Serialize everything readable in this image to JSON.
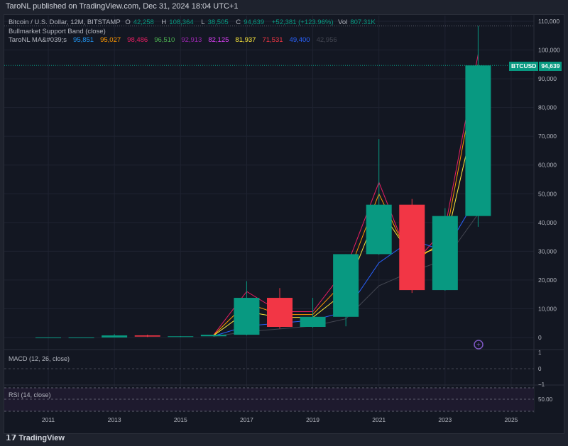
{
  "header": {
    "published": "TaroNL published on TradingView.com, Dec 31, 2024 18:04 UTC+1"
  },
  "legend": {
    "symbol": "Bitcoin / U.S. Dollar, 12M, BITSTAMP",
    "o_label": "O",
    "o": "42,258",
    "h_label": "H",
    "h": "108,364",
    "l_label": "L",
    "l": "38,505",
    "c_label": "C",
    "c": "94,639",
    "change": "+52,381 (+123.96%)",
    "vol_label": "Vol",
    "vol": "807.31K",
    "band": "Bullmarket Support Band (close)",
    "ma_title": "TaroNL MA&#039;s",
    "ma_values": [
      {
        "v": "95,851",
        "color": "#2196f3"
      },
      {
        "v": "95,027",
        "color": "#ff9800"
      },
      {
        "v": "98,486",
        "color": "#e91e63"
      },
      {
        "v": "96,510",
        "color": "#4caf50"
      },
      {
        "v": "92,913",
        "color": "#9c27b0"
      },
      {
        "v": "82,125",
        "color": "#e040fb"
      },
      {
        "v": "81,937",
        "color": "#ffeb3b"
      },
      {
        "v": "71,531",
        "color": "#f23645"
      },
      {
        "v": "49,400",
        "color": "#2962ff"
      },
      {
        "v": "42,956",
        "color": "#434651"
      }
    ]
  },
  "price_tag": {
    "symbol": "BTCUSD",
    "value": "94,639"
  },
  "macd": {
    "label": "MACD (12, 26, close)",
    "ticks": [
      "1",
      "0",
      "−1"
    ]
  },
  "rsi": {
    "label": "RSI (14, close)",
    "tick": "50.00"
  },
  "brand": "TradingView",
  "colors": {
    "up": "#089981",
    "down": "#f23645"
  },
  "chart_data": {
    "type": "candlestick",
    "ylim": [
      0,
      110000
    ],
    "yticks": [
      0,
      10000,
      20000,
      30000,
      40000,
      50000,
      60000,
      70000,
      80000,
      90000,
      100000,
      110000
    ],
    "ytick_labels": [
      "0",
      "10,000",
      "20,000",
      "30,000",
      "40,000",
      "50,000",
      "60,000",
      "70,000",
      "80,000",
      "90,000",
      "100,000",
      "110,000"
    ],
    "xticks": [
      "2011",
      "2013",
      "2015",
      "2017",
      "2019",
      "2021",
      "2023",
      "2025"
    ],
    "candles": [
      {
        "year": 2011,
        "o": 0.3,
        "h": 32,
        "l": 0.3,
        "c": 4.7
      },
      {
        "year": 2012,
        "o": 4.7,
        "h": 16,
        "l": 4,
        "c": 13
      },
      {
        "year": 2013,
        "o": 13,
        "h": 1160,
        "l": 13,
        "c": 730
      },
      {
        "year": 2014,
        "o": 730,
        "h": 1000,
        "l": 180,
        "c": 320
      },
      {
        "year": 2015,
        "o": 320,
        "h": 500,
        "l": 150,
        "c": 430
      },
      {
        "year": 2016,
        "o": 430,
        "h": 980,
        "l": 350,
        "c": 960
      },
      {
        "year": 2017,
        "o": 960,
        "h": 19600,
        "l": 750,
        "c": 13800
      },
      {
        "year": 2018,
        "o": 13800,
        "h": 17200,
        "l": 3100,
        "c": 3700
      },
      {
        "year": 2019,
        "o": 3700,
        "h": 13800,
        "l": 3400,
        "c": 7200
      },
      {
        "year": 2020,
        "o": 7200,
        "h": 29000,
        "l": 3900,
        "c": 29000
      },
      {
        "year": 2021,
        "o": 29000,
        "h": 69000,
        "l": 28800,
        "c": 46200
      },
      {
        "year": 2022,
        "o": 46200,
        "h": 48200,
        "l": 15500,
        "c": 16500
      },
      {
        "year": 2023,
        "o": 16500,
        "h": 45000,
        "l": 16300,
        "c": 42258
      },
      {
        "year": 2024,
        "o": 42258,
        "h": 108364,
        "l": 38505,
        "c": 94639
      }
    ],
    "ma_lines": [
      {
        "color": "#e91e63",
        "values": [
          [
            2016,
            900
          ],
          [
            2017,
            16000
          ],
          [
            2018,
            9000
          ],
          [
            2019,
            9000
          ],
          [
            2020,
            24000
          ],
          [
            2021,
            54000
          ],
          [
            2022,
            25000
          ],
          [
            2023,
            38000
          ],
          [
            2024,
            98486
          ]
        ]
      },
      {
        "color": "#ff9800",
        "values": [
          [
            2016,
            800
          ],
          [
            2017,
            12000
          ],
          [
            2018,
            8000
          ],
          [
            2019,
            8000
          ],
          [
            2020,
            20000
          ],
          [
            2021,
            50000
          ],
          [
            2022,
            26000
          ],
          [
            2023,
            34000
          ],
          [
            2024,
            95027
          ]
        ]
      },
      {
        "color": "#ffeb3b",
        "values": [
          [
            2016,
            700
          ],
          [
            2017,
            9000
          ],
          [
            2018,
            7000
          ],
          [
            2019,
            7000
          ],
          [
            2020,
            16000
          ],
          [
            2021,
            45000
          ],
          [
            2022,
            28000
          ],
          [
            2023,
            32000
          ],
          [
            2024,
            81937
          ]
        ]
      },
      {
        "color": "#2962ff",
        "values": [
          [
            2016,
            500
          ],
          [
            2017,
            4000
          ],
          [
            2018,
            5000
          ],
          [
            2019,
            6000
          ],
          [
            2020,
            9000
          ],
          [
            2021,
            26000
          ],
          [
            2022,
            34000
          ],
          [
            2023,
            30000
          ],
          [
            2024,
            49400
          ]
        ]
      },
      {
        "color": "#434651",
        "values": [
          [
            2016,
            400
          ],
          [
            2017,
            2000
          ],
          [
            2018,
            3000
          ],
          [
            2019,
            4000
          ],
          [
            2020,
            6500
          ],
          [
            2021,
            18000
          ],
          [
            2022,
            23000
          ],
          [
            2023,
            27000
          ],
          [
            2024,
            42956
          ]
        ]
      }
    ]
  }
}
